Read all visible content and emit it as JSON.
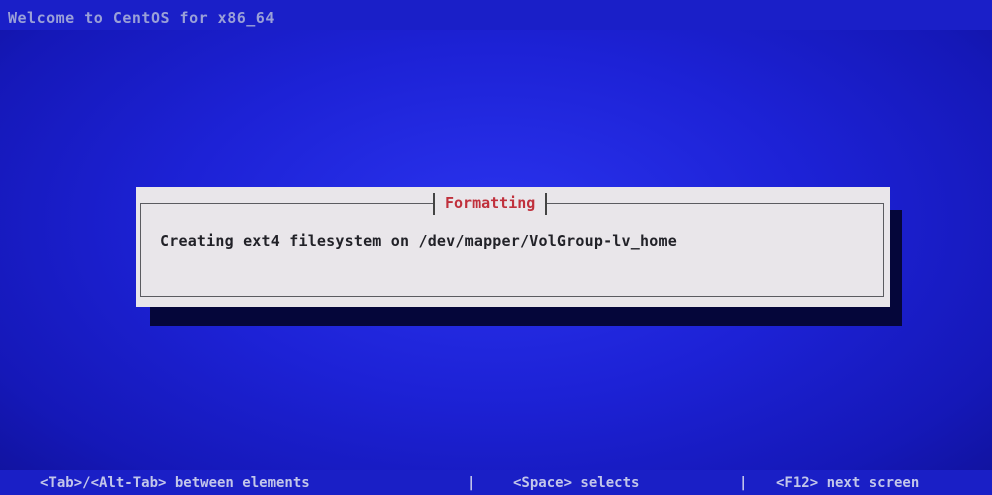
{
  "header": {
    "title": "Welcome to CentOS for x86_64"
  },
  "dialog": {
    "title": "Formatting",
    "message": "Creating ext4 filesystem on /dev/mapper/VolGroup-lv_home"
  },
  "status_bar": {
    "hint_tab": "<Tab>/<Alt-Tab> between elements",
    "separator": "|",
    "hint_space": "<Space> selects",
    "hint_f12": "<F12> next screen"
  },
  "colors": {
    "background": "#1d22d6",
    "dialog_bg": "#e9e6ea",
    "dialog_title": "#c0303c",
    "text_dark": "#222228",
    "text_light": "#c2c6ea"
  }
}
